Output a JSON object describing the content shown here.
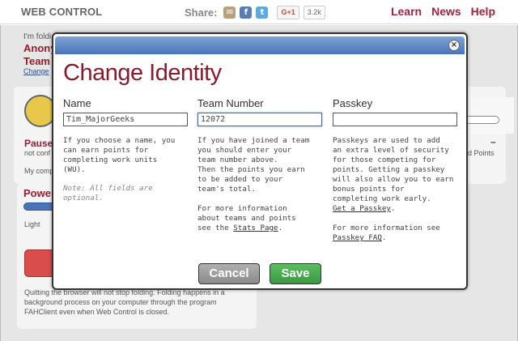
{
  "header": {
    "brand": "WEB CONTROL",
    "share_label": "Share:",
    "share_icons": [
      "mail-icon",
      "facebook-icon",
      "twitter-icon"
    ],
    "gplus_label": "G+1",
    "gplus_count": "3.2k",
    "nav": [
      "Learn",
      "News",
      "Help"
    ]
  },
  "background": {
    "folding_line": "I'm foldi",
    "user_line": "Anonym",
    "team_line": "Team C",
    "change_link": "Change",
    "paused": "Paused",
    "not_configured": "not conf",
    "my_computer": "My comp",
    "power": "Power",
    "light": "Light",
    "points": "d Points",
    "dash": "–",
    "footer": [
      "Quitting the browser will not stop folding. Folding happens in a",
      "background process on your computer through the program",
      "FAHClient even when Web Control is closed."
    ]
  },
  "modal": {
    "title": "Change Identity",
    "close_symbol": "×",
    "name": {
      "label": "Name",
      "value": "Tim_MajorGeeks",
      "help": [
        "If you choose a name, you",
        "can earn points for",
        "completing work units",
        "(WU)."
      ],
      "note": [
        "Note: All fields are",
        "optional."
      ]
    },
    "team": {
      "label": "Team Number",
      "value": "12072",
      "help": [
        "If you have joined a team",
        "you should enter your",
        "team number above.",
        "Then the points you earn",
        "to be added to your",
        "team's total."
      ],
      "more_lines": [
        "For more information",
        "about teams and points"
      ],
      "more_prefix": "see the ",
      "stats_link": "Stats Page",
      "more_suffix": "."
    },
    "passkey": {
      "label": "Passkey",
      "value": "",
      "help": [
        "Passkeys are used to add",
        "an extra level of security",
        "for those competing for",
        "points. Getting a passkey",
        "will also allow you to earn",
        "bonus points for",
        "completing work early."
      ],
      "get_link": "Get a Passkey",
      "get_suffix": ".",
      "more_line": "For more information see",
      "faq_link": "Passkey FAQ",
      "faq_suffix": "."
    },
    "buttons": {
      "cancel": "Cancel",
      "save": "Save"
    }
  }
}
